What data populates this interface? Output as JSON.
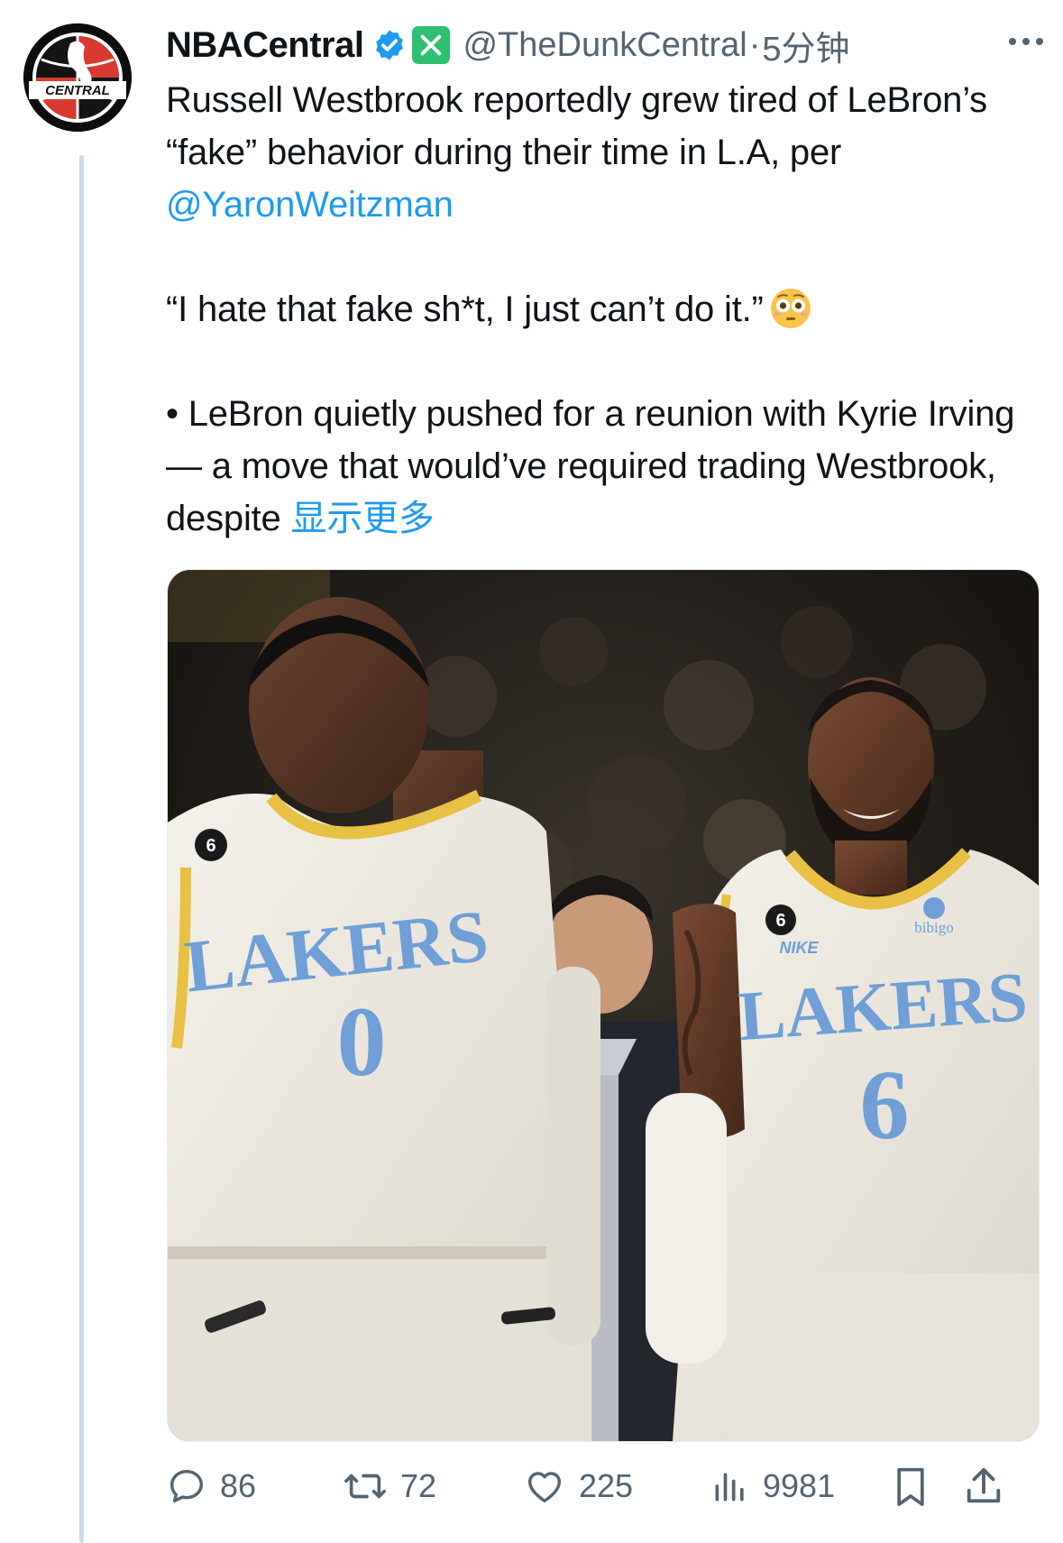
{
  "author": {
    "display_name": "NBACentral",
    "handle": "@TheDunkCentral",
    "separator": "·",
    "timestamp": "5分钟",
    "avatar_text": "CENTRAL"
  },
  "tweet": {
    "line1_prefix": "Russell Westbrook reportedly grew tired of LeBron’s “fake” behavior during their time in L.A, per ",
    "mention": "@YaronWeitzman",
    "quote": "“I hate that fake sh*t, I just can’t do it.”",
    "bullet": "• LeBron quietly pushed for a reunion with Kyrie Irving — a move that would’ve required trading Westbrook, despite ",
    "show_more": "显示更多"
  },
  "media": {
    "left_jersey_team": "LAKERS",
    "left_jersey_number": "0",
    "left_patch": "6",
    "right_jersey_team": "LAKERS",
    "right_jersey_number": "6",
    "right_patch": "6",
    "right_sponsor": "bibigo",
    "right_brand": "NIKE"
  },
  "actions": {
    "replies": "86",
    "reposts": "72",
    "likes": "225",
    "views": "9981"
  },
  "colors": {
    "link": "#1d9bf0",
    "muted": "#536471",
    "verified": "#1d9bf0",
    "affiliate_badge": "#2fbf71",
    "jersey_blue": "#6f9fd6",
    "jersey_gold": "#e8c043"
  },
  "icons": [
    "verified-badge-icon",
    "affiliate-x-icon",
    "more-icon",
    "reply-icon",
    "repost-icon",
    "like-icon",
    "views-icon",
    "bookmark-icon",
    "share-icon",
    "flushed-face-emoji"
  ]
}
